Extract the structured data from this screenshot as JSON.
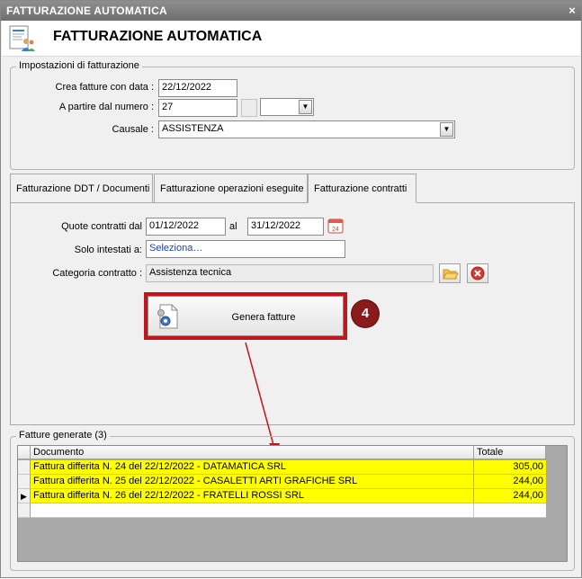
{
  "window": {
    "title": "FATTURAZIONE AUTOMATICA",
    "close_glyph": "×",
    "header_title": "FATTURAZIONE AUTOMATICA",
    "header_icon": "invoice-people-icon"
  },
  "settings": {
    "legend": "Impostazioni di fatturazione",
    "date_label": "Crea fatture con data :",
    "date_value": "22/12/2022",
    "number_label": "A partire dal numero :",
    "number_value": "27",
    "series_value": "",
    "causale_label": "Causale :",
    "causale_value": "ASSISTENZA"
  },
  "tabs": [
    {
      "label": "Fatturazione DDT / Documenti",
      "active": false
    },
    {
      "label": "Fatturazione operazioni eseguite",
      "active": false
    },
    {
      "label": "Fatturazione contratti",
      "active": true
    }
  ],
  "contracts": {
    "period_label": "Quote contratti dal",
    "from_date": "01/12/2022",
    "to_label": "al",
    "to_date": "31/12/2022",
    "calendar_day": "24",
    "holders_label": "Solo intestati a:",
    "holders_value": "Seleziona…",
    "category_label": "Categoria contratto :",
    "category_value": "Assistenza tecnica",
    "generate_label": "Genera fatture",
    "step_badge": "4"
  },
  "generated": {
    "legend": "Fatture generate (3)",
    "columns": [
      "Documento",
      "Totale"
    ],
    "rows": [
      {
        "doc": "Fattura differita N. 24 del 22/12/2022 - DATAMATICA SRL",
        "total": "305,00"
      },
      {
        "doc": "Fattura differita N. 25 del 22/12/2022 - CASALETTI ARTI GRAFICHE SRL",
        "total": "244,00"
      },
      {
        "doc": "Fattura differita N. 26 del 22/12/2022 - FRATELLI ROSSI SRL",
        "total": "244,00",
        "current": true
      }
    ],
    "current_row_marker": "▶",
    "highlight_color": "#ffff00"
  },
  "colors": {
    "annotation_red": "#c0171d",
    "badge_red": "#8b1a1a",
    "link_blue": "#1a3fb0"
  }
}
